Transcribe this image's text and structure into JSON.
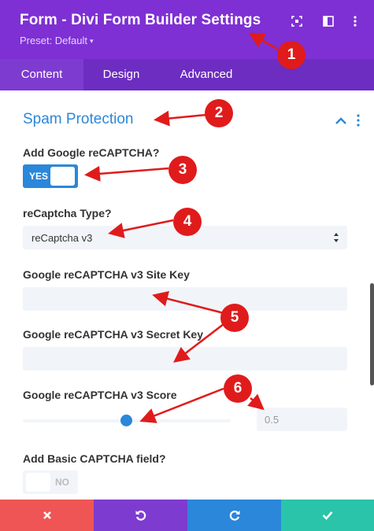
{
  "header": {
    "title": "Form - Divi Form Builder Settings",
    "preset": "Preset: Default"
  },
  "tabs": [
    {
      "label": "Content",
      "active": true
    },
    {
      "label": "Design",
      "active": false
    },
    {
      "label": "Advanced",
      "active": false
    }
  ],
  "section": {
    "title": "Spam Protection",
    "recaptcha_label": "Add Google reCAPTCHA?",
    "recaptcha_toggle": "YES",
    "type_label": "reCaptcha Type?",
    "type_value": "reCaptcha v3",
    "site_key_label": "Google reCAPTCHA v3 Site Key",
    "site_key_value": "",
    "secret_key_label": "Google reCAPTCHA v3 Secret Key",
    "secret_key_value": "",
    "score_label": "Google reCAPTCHA v3 Score",
    "score_value": "0.5",
    "score_fraction": 0.5,
    "basic_captcha_label": "Add Basic CAPTCHA field?",
    "basic_captcha_toggle": "NO"
  },
  "callouts": [
    "1",
    "2",
    "3",
    "4",
    "5",
    "6"
  ],
  "colors": {
    "header": "#7e30d4",
    "tabs": "#6c2dc0",
    "accent": "#2b87da",
    "cancel": "#ef5555",
    "undo": "#7e3bd0",
    "redo": "#2b87da",
    "save": "#29c4a9",
    "callout": "#e01b1b"
  },
  "icons": {
    "header": [
      "expand-icon",
      "sidebar-icon",
      "more-icon"
    ],
    "footer": [
      "close-icon",
      "undo-icon",
      "redo-icon",
      "check-icon"
    ]
  }
}
